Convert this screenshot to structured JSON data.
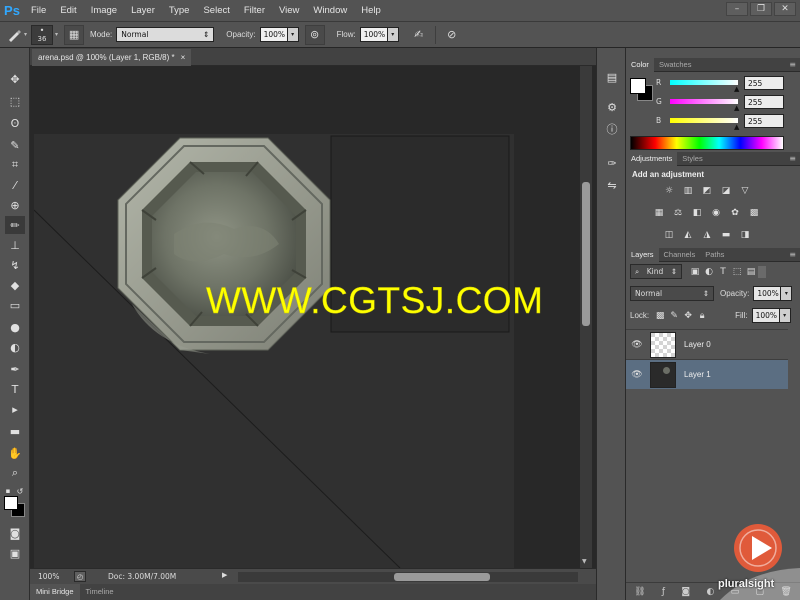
{
  "app": {
    "logo": "Ps"
  },
  "menu": [
    "File",
    "Edit",
    "Image",
    "Layer",
    "Type",
    "Select",
    "Filter",
    "View",
    "Window",
    "Help"
  ],
  "window_controls": [
    "–",
    "❐",
    "✕"
  ],
  "options": {
    "brush_size": "36",
    "mode_label": "Mode:",
    "mode_value": "Normal",
    "opacity_label": "Opacity:",
    "opacity_value": "100%",
    "flow_label": "Flow:",
    "flow_value": "100%"
  },
  "document": {
    "tab_title": "arena.psd @ 100% (Layer 1, RGB/8) *",
    "close": "×"
  },
  "status": {
    "zoom": "100%",
    "doc_size": "Doc: 3.00M/7.00M"
  },
  "bottom_tabs": [
    "Mini Bridge",
    "Timeline"
  ],
  "color_panel": {
    "tabs": [
      "Color",
      "Swatches"
    ],
    "sliders": [
      {
        "label": "R",
        "value": "255",
        "gradient": "#00ffff"
      },
      {
        "label": "G",
        "value": "255",
        "gradient": "#ff00ff"
      },
      {
        "label": "B",
        "value": "255",
        "gradient": "#ffff00"
      }
    ]
  },
  "adjustments": {
    "tabs": [
      "Adjustments",
      "Styles"
    ],
    "title": "Add an adjustment"
  },
  "layers_panel": {
    "tabs": [
      "Layers",
      "Channels",
      "Paths"
    ],
    "filter_label": "Kind",
    "blend_mode": "Normal",
    "opacity_label": "Opacity:",
    "opacity_value": "100%",
    "lock_label": "Lock:",
    "fill_label": "Fill:",
    "fill_value": "100%",
    "layers": [
      {
        "name": "Layer 0",
        "selected": false
      },
      {
        "name": "Layer 1",
        "selected": true
      }
    ]
  },
  "watermark": "WWW.CGTSJ.COM",
  "brand": "pluralsight",
  "colors": {
    "accent": "#31a8ff",
    "selection": "#5b6e82",
    "watermark": "#ffff00",
    "pluralsight": "#e05a3a"
  }
}
